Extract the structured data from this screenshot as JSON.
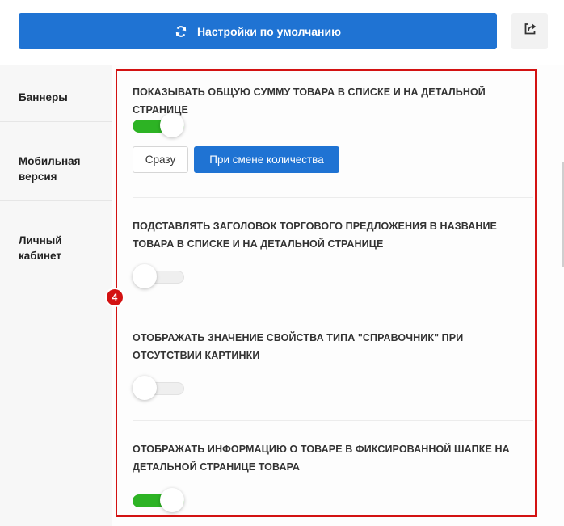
{
  "toolbar": {
    "default_label": "Настройки по умолчанию",
    "refresh_icon": "refresh-icon",
    "share_icon": "share-icon"
  },
  "sidebar": {
    "items": [
      {
        "label": "Баннеры"
      },
      {
        "label": "Мобильная\nверсия"
      },
      {
        "label": "Личный\nкабинет"
      }
    ]
  },
  "marker": {
    "number": "4"
  },
  "settings": [
    {
      "label": "Показывать общую сумму товара в списке и на детальной странице",
      "enabled": true,
      "options": [
        "Сразу",
        "При смене количества"
      ],
      "selected_option": "При смене количества"
    },
    {
      "label": "Подставлять заголовок торгового предложения в название товара в списке и на детальной странице",
      "enabled": false
    },
    {
      "label": "Отображать значение свойства типа \"справочник\" при отсутствии картинки",
      "enabled": false
    },
    {
      "label": "Отображать информацию о товаре в фиксированной шапке на детальной странице товара",
      "enabled": true
    }
  ],
  "colors": {
    "primary": "#1f73d3",
    "toggle_on": "#2db324",
    "highlight": "#d31212"
  }
}
